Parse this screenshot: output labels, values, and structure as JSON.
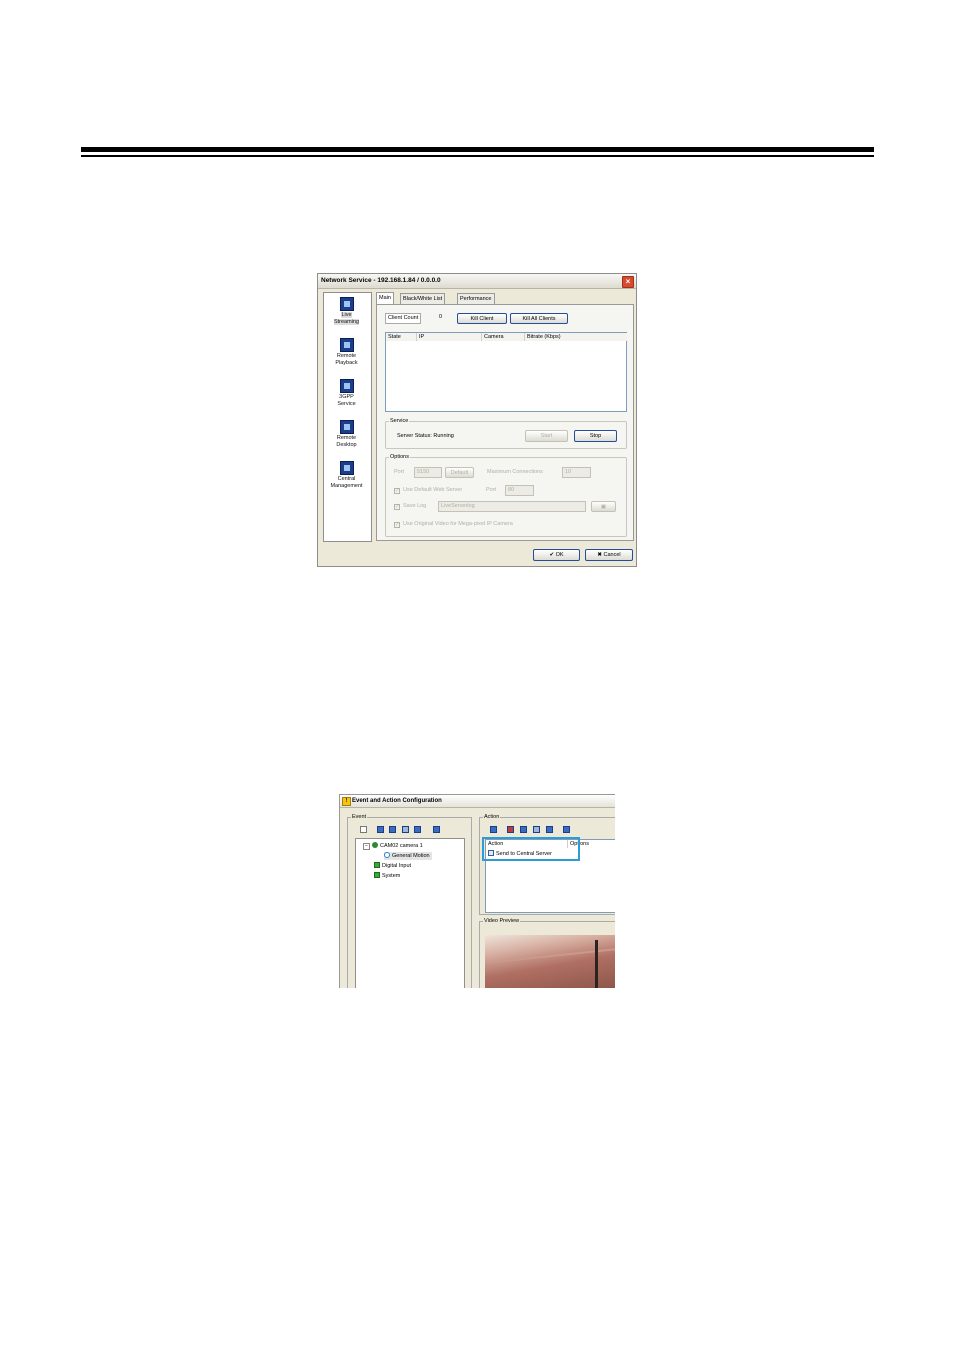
{
  "network_service": {
    "title": "Network Service - 192.168.1.84 / 0.0.0.0",
    "nav": [
      {
        "label1": "Live",
        "label2": "Streaming",
        "icon": "live-streaming-icon"
      },
      {
        "label1": "Remote",
        "label2": "Playback",
        "icon": "remote-playback-icon"
      },
      {
        "label1": "3GPP",
        "label2": "Service",
        "icon": "3gpp-service-icon"
      },
      {
        "label1": "Remote",
        "label2": "Desktop",
        "icon": "remote-desktop-icon"
      },
      {
        "label1": "Central",
        "label2": "Management",
        "icon": "central-management-icon"
      }
    ],
    "tabs": [
      "Main",
      "Black/White List",
      "Performance"
    ],
    "client_count_label": "Client Count",
    "client_count_value": "0",
    "kill_client": "Kill Client",
    "kill_all_clients": "Kill All Clients",
    "columns": [
      "State",
      "IP",
      "Camera",
      "Bitrate (Kbps)"
    ],
    "service": {
      "group": "Service",
      "status": "Server Status: Running",
      "start": "Start",
      "stop": "Stop"
    },
    "options": {
      "group": "Options",
      "port_label": "Port",
      "port_value": "5150",
      "default_btn": "Default",
      "max_conn_label": "Maximum Connections",
      "max_conn_value": "10",
      "use_default_web": "Use Default Web Server",
      "web_port_label": "Port",
      "web_port_value": "80",
      "save_log": "Save Log",
      "save_log_path": "LiveServerlog",
      "use_original": "Use Original Video for Mega-pixel IP Camera"
    },
    "ok": "OK",
    "cancel": "Cancel"
  },
  "event_action": {
    "title": "Event and Action Configuration",
    "event_group": "Event",
    "action_group": "Action",
    "tree": {
      "camera": "CAM02 camera 1",
      "motion": "General Motion",
      "digital_input": "Digital Input",
      "system": "System"
    },
    "action_columns": [
      "Action",
      "Options"
    ],
    "action_item": "Send to Central Server",
    "video_preview": "Video Preview"
  },
  "colors": {
    "highlight": "#2c9bd6",
    "close": "#d84a2e"
  }
}
